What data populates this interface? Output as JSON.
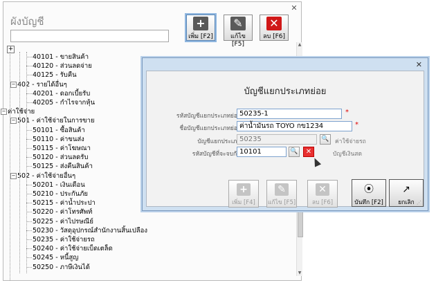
{
  "chart_window": {
    "title": "ผังบัญชี",
    "close_glyph": "✕",
    "toolbar": {
      "add": {
        "label": "เพิ่ม [F2]",
        "icon": "plus-icon",
        "color": "#5a5a5a"
      },
      "edit": {
        "label": "แก้ไข [F5]",
        "icon": "pencil-icon",
        "color": "#5a5a5a"
      },
      "delete": {
        "label": "ลบ [F6]",
        "icon": "delete-x-icon",
        "color": "#d01818"
      }
    },
    "search_value": "",
    "expand_glyph": "+",
    "tree": [
      {
        "label": "40101 - ขายสินค้า",
        "level": 3
      },
      {
        "label": "40120 - ส่วนลดจ่าย",
        "level": 3
      },
      {
        "label": "40125 - รับคืน",
        "level": 3
      },
      {
        "label": "402 - รายได้อื่นๆ",
        "level": 2,
        "toggle": "−"
      },
      {
        "label": "40201 - ดอกเบี้ยรับ",
        "level": 3
      },
      {
        "label": "40205 - กำไรจากหุ้น",
        "level": 3
      },
      {
        "label": "ค่าใช้จ่าย",
        "level": 1,
        "toggle": "−"
      },
      {
        "label": "501 - ค่าใช้จ่ายในการขาย",
        "level": 2,
        "toggle": "−"
      },
      {
        "label": "50101 - ซื้อสินค้า",
        "level": 3
      },
      {
        "label": "50110 - ค่าขนส่ง",
        "level": 3
      },
      {
        "label": "50115 - ค่าโฆษณา",
        "level": 3
      },
      {
        "label": "50120 - ส่วนลดรับ",
        "level": 3
      },
      {
        "label": "50125 - ส่งคืนสินค้า",
        "level": 3
      },
      {
        "label": "502 - ค่าใช้จ่ายอื่นๆ",
        "level": 2,
        "toggle": "−"
      },
      {
        "label": "50201 - เงินเดือน",
        "level": 3
      },
      {
        "label": "50210 - ประกันภัย",
        "level": 3
      },
      {
        "label": "50215 - ค่าน้ำประปา",
        "level": 3
      },
      {
        "label": "50220 - ค่าโทรศัพท์",
        "level": 3
      },
      {
        "label": "50225 - ค่าไปรษณีย์",
        "level": 3
      },
      {
        "label": "50230 - วัสดุอุปกรณ์สำนักงานสิ้นเปลือง",
        "level": 3
      },
      {
        "label": "50235 - ค่าใช้จ่ายรถ",
        "level": 3
      },
      {
        "label": "50240 - ค่าใช้จ่ายเบ็ดเตล็ด",
        "level": 3
      },
      {
        "label": "50245 - หนี้สูญ",
        "level": 3
      },
      {
        "label": "50250 - ภาษีเงินได้",
        "level": 3
      }
    ]
  },
  "dialog": {
    "close_glyph": "✕",
    "title": "บัญชีแยกประเภทย่อย",
    "fields": {
      "sub_code": {
        "label": "รหัสบัญชีแยกประเภทย่อย",
        "value": "50235-1"
      },
      "sub_name": {
        "label": "ชื่อบัญชีแยกประเภทย่อย",
        "value": "ค่าน้ำมันรถ TOYO กข1234"
      },
      "ledger": {
        "label": "บัญชีแยกประเภท",
        "value": "50235",
        "hint": "ค่าใช้จ่ายรถ"
      },
      "pair": {
        "label": "รหัสบัญชีที่จะจบกัน",
        "value": "10101",
        "hint": "บัญชีเงินสด"
      }
    },
    "required_glyph": "*",
    "search_glyph": "🔍",
    "clear_glyph": "✕",
    "buttons": {
      "add": {
        "label": "เพิ่ม [F4]",
        "glyph": "+"
      },
      "edit": {
        "label": "แก้ไข [F5]",
        "glyph": "✎"
      },
      "delete": {
        "label": "ลบ [F6]",
        "glyph": "✕"
      },
      "save": {
        "label": "บันทึก [F2]",
        "glyph": "⦿"
      },
      "cancel": {
        "label": "ยกเลิก",
        "glyph": "↗"
      }
    },
    "grip_glyph": "⋰"
  }
}
